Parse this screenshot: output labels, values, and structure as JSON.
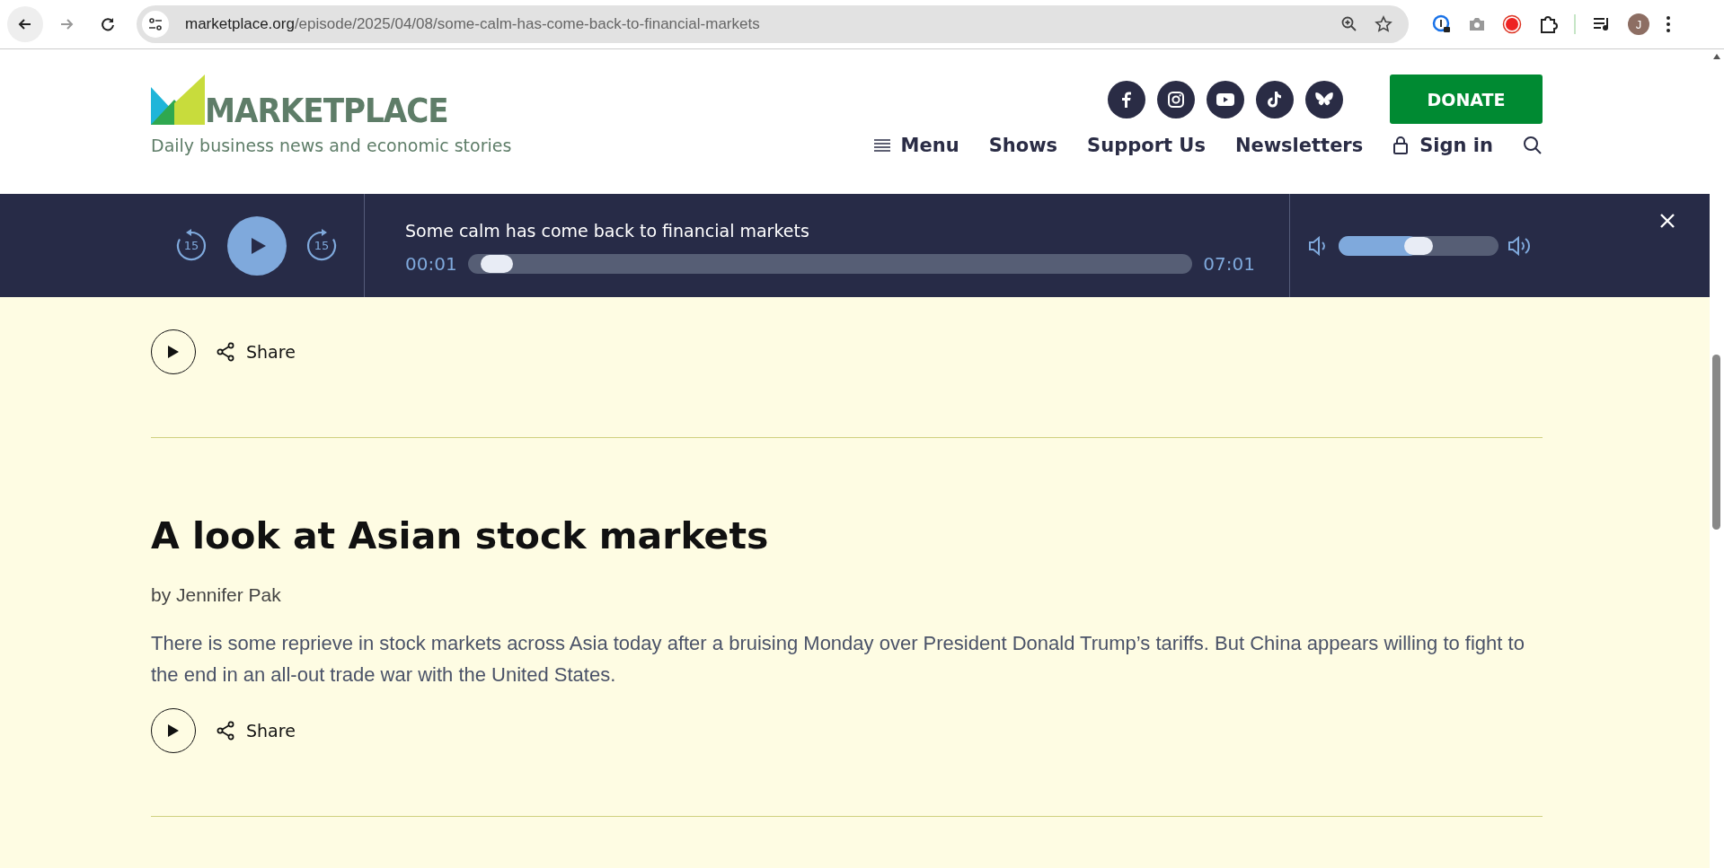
{
  "browser": {
    "url_host": "marketplace.org",
    "url_path": "/episode/2025/04/08/some-calm-has-come-back-to-financial-markets",
    "profile_initial": "J"
  },
  "header": {
    "logo": "MARKETPLACE",
    "tagline": "Daily business news and economic stories",
    "donate": "DONATE",
    "nav": [
      {
        "label": "Menu",
        "kind": "menu"
      },
      {
        "label": "Shows",
        "kind": "link"
      },
      {
        "label": "Support Us",
        "kind": "link"
      },
      {
        "label": "Newsletters",
        "kind": "link"
      },
      {
        "label": "Sign in",
        "kind": "signin"
      }
    ]
  },
  "player": {
    "skip_back": "15",
    "skip_forward": "15",
    "title": "Some calm has come back to financial markets",
    "elapsed": "00:01",
    "duration": "07:01",
    "progress": {
      "level": 0.02
    },
    "volume": {
      "level": 0.5
    }
  },
  "stories": [
    {
      "share": "Share"
    },
    {
      "title": "A look at Asian stock markets",
      "byline": "by Jennifer Pak",
      "summary": "There is some reprieve in stock markets across Asia today after a bruising Monday over President Donald Trump’s tariffs. But China appears willing to fight to the end in an all-out trade war with the United States.",
      "share": "Share"
    }
  ]
}
